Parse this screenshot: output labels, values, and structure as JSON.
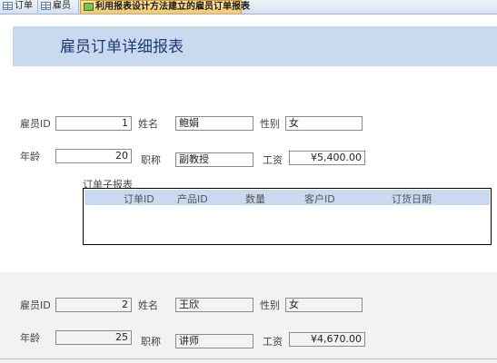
{
  "tabs": [
    {
      "label": "订单",
      "icon": "table-icon"
    },
    {
      "label": "雇员",
      "icon": "table-icon"
    },
    {
      "label": "利用报表设计方法建立的雇员订单报表",
      "icon": "report-icon",
      "active": true
    }
  ],
  "report": {
    "title": "雇员订单详细报表"
  },
  "labels": {
    "employee_id": "雇员ID",
    "name": "姓名",
    "gender": "性别",
    "age": "年龄",
    "position": "职称",
    "salary": "工资",
    "subreport": "订单子报表"
  },
  "subreport_columns": [
    "订单ID",
    "产品ID",
    "数量",
    "客户ID",
    "订货日期"
  ],
  "records": [
    {
      "employee_id": "1",
      "name": "鲍娟",
      "gender": "女",
      "age": "20",
      "position": "副教授",
      "salary": "¥5,400.00"
    },
    {
      "employee_id": "2",
      "name": "王欣",
      "gender": "女",
      "age": "25",
      "position": "讲师",
      "salary": "¥4,670.00"
    }
  ]
}
